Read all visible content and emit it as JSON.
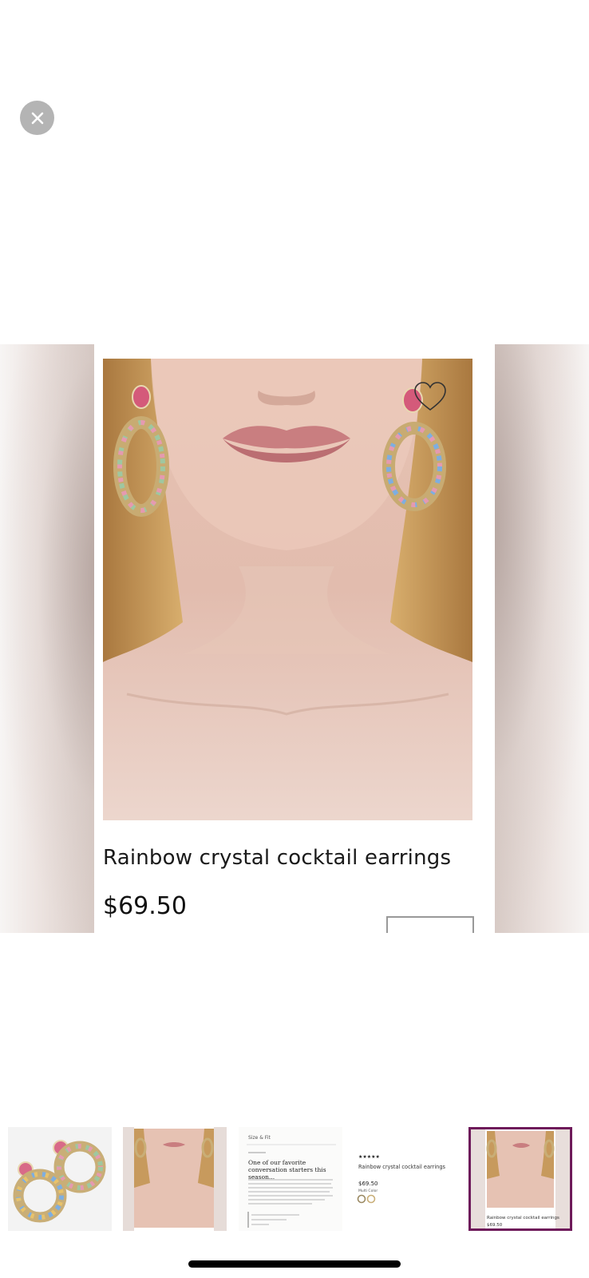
{
  "viewer": {
    "close_icon": "close-icon",
    "close_button_color": "#b4b4b4"
  },
  "product": {
    "title": "Rainbow crystal cocktail earrings",
    "price": "$69.50",
    "wishlist_icon": "heart-outline-icon"
  },
  "thumbnails": [
    {
      "name": "thumb-earrings-product",
      "kind": "product-shot",
      "selected": false
    },
    {
      "name": "thumb-model-photo",
      "kind": "model-shot",
      "selected": false
    },
    {
      "name": "thumb-details-page",
      "kind": "details-screenshot",
      "selected": false,
      "heading": "Size & Fit",
      "title": "One of our favorite conversation starters this season..."
    },
    {
      "name": "thumb-listing-page",
      "kind": "listing-screenshot",
      "selected": false,
      "stars": "★★★★★",
      "product_name": "Rainbow crystal cocktail earrings",
      "price": "$69.50",
      "color_label": "Multi Color"
    },
    {
      "name": "thumb-current-view",
      "kind": "model-card",
      "selected": true,
      "caption": "Rainbow crystal cocktail earrings",
      "price": "$69.50"
    }
  ],
  "colors": {
    "selected_border": "#6e1a5a",
    "background": "#ffffff"
  }
}
